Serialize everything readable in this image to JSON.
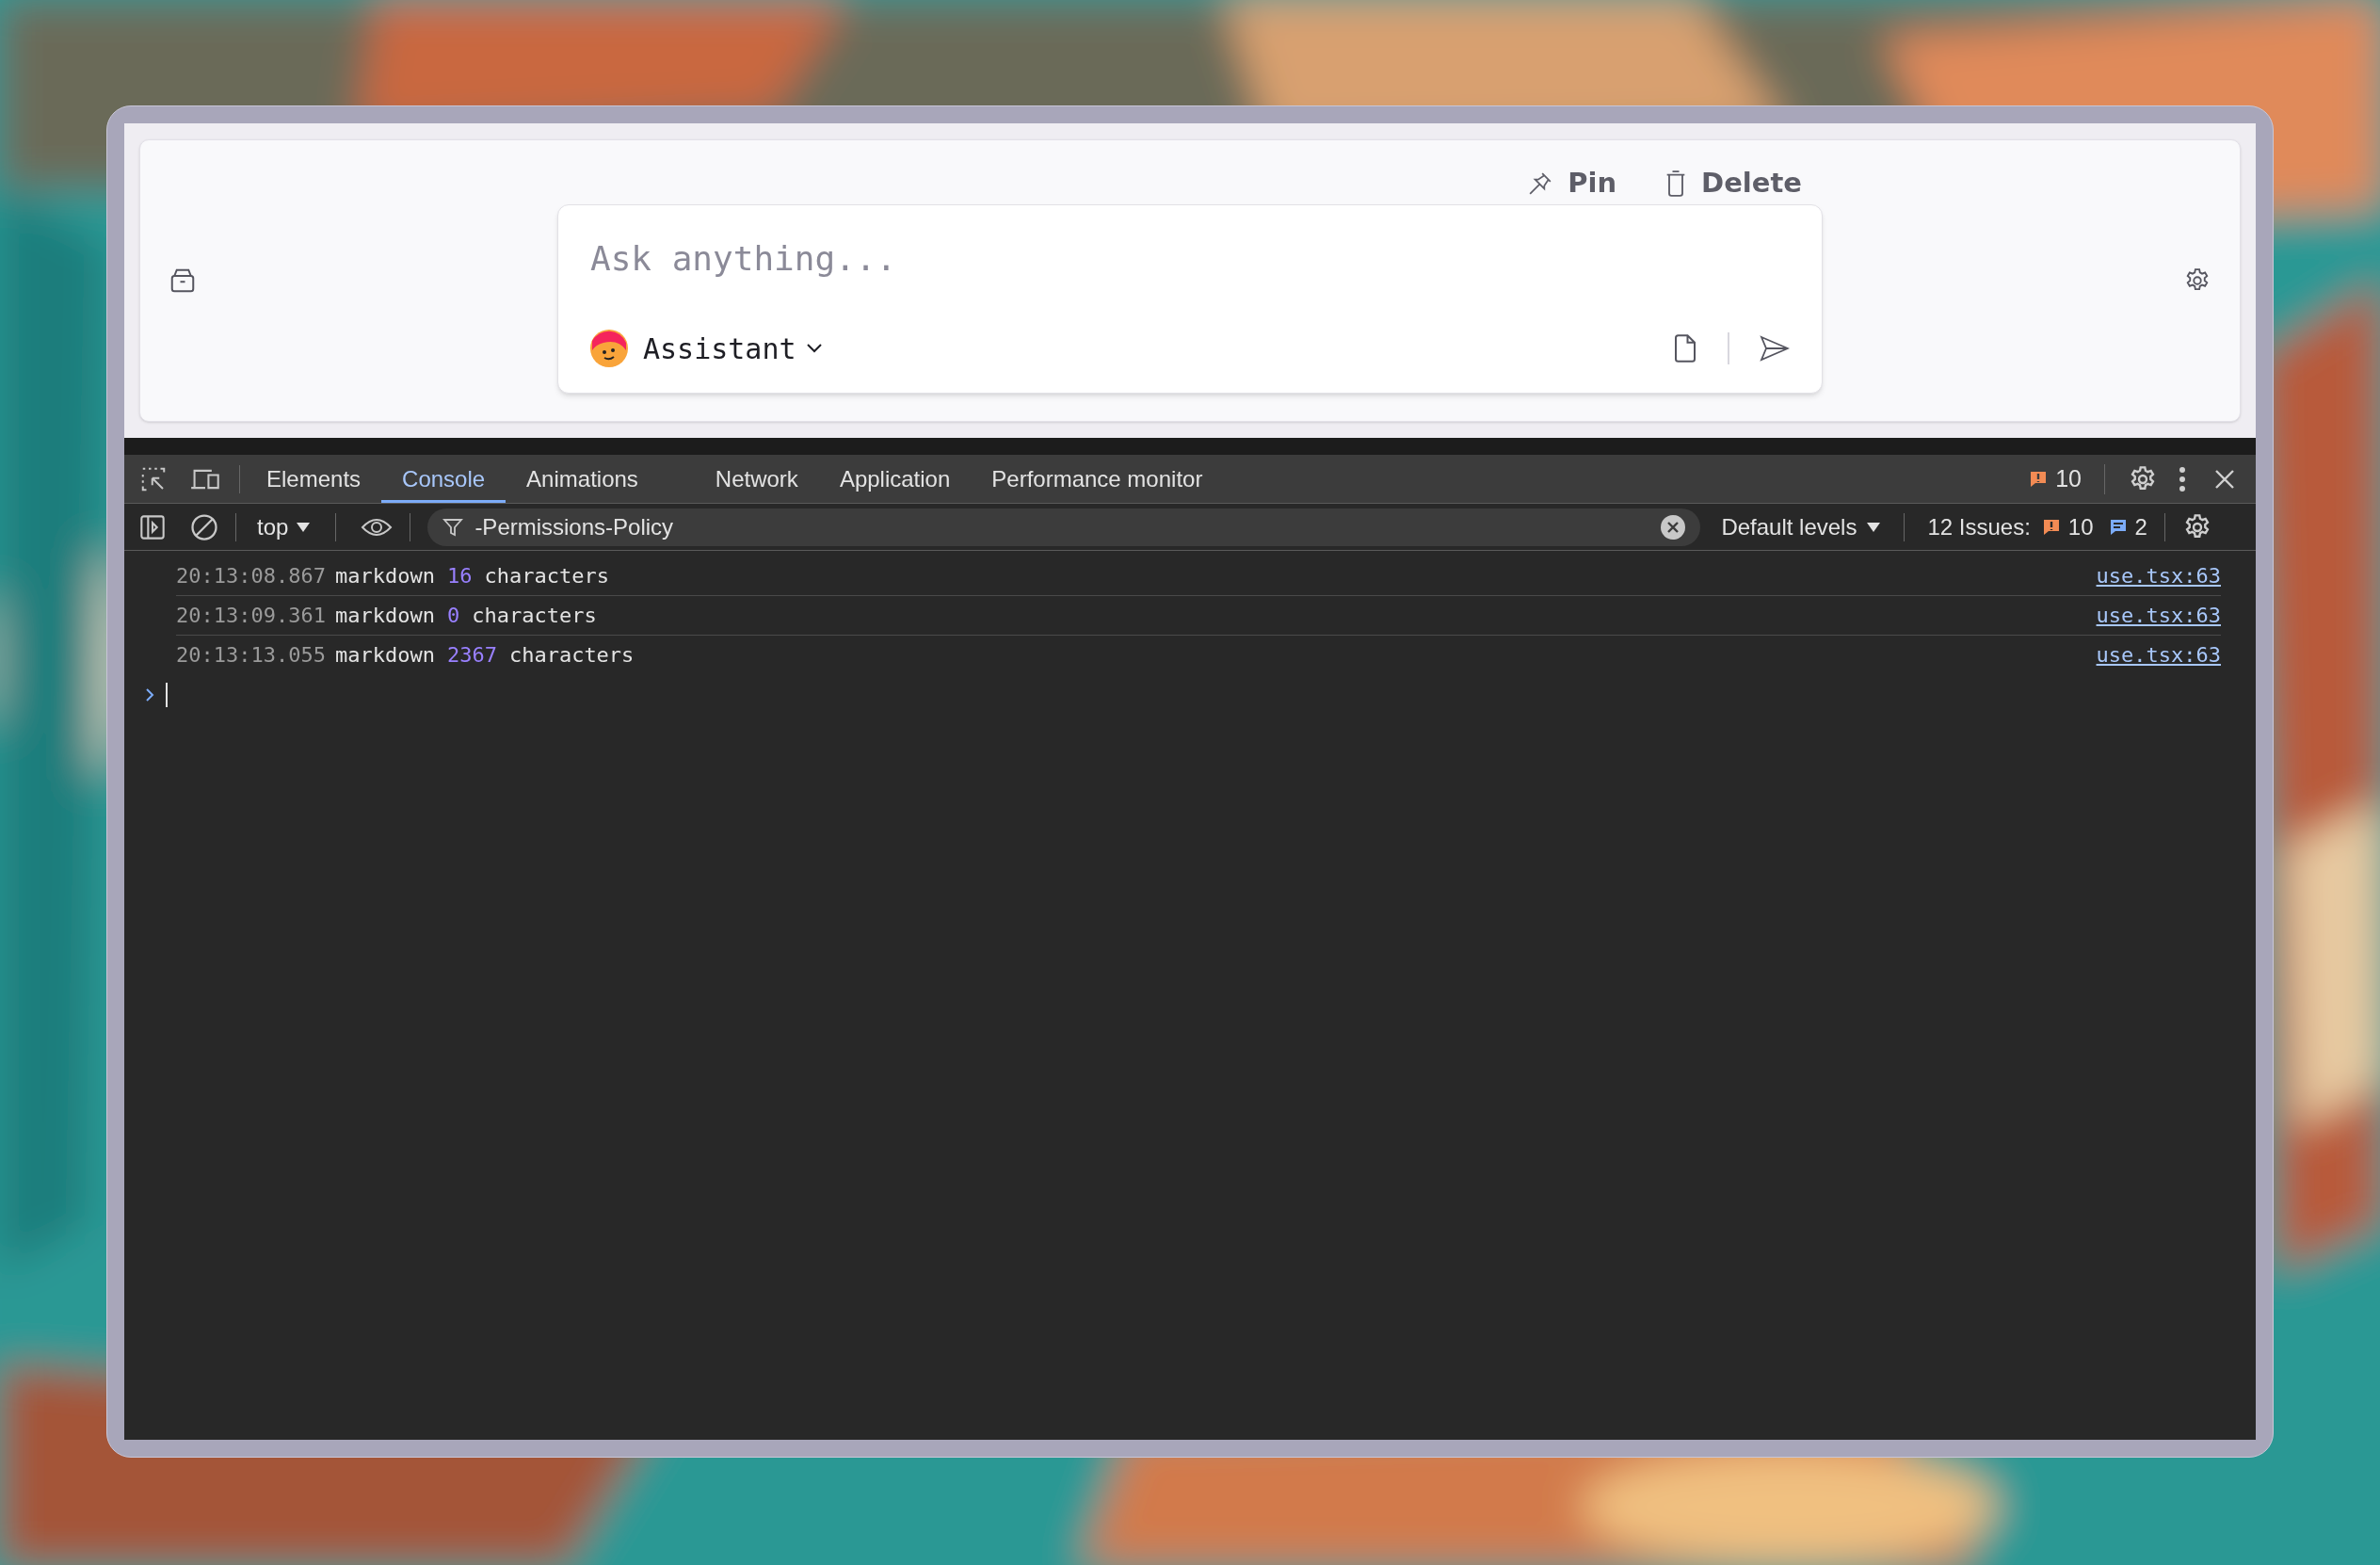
{
  "chat": {
    "actions": [
      {
        "kind": "pin",
        "label": "Pin"
      },
      {
        "kind": "delete",
        "label": "Delete"
      }
    ],
    "input": {
      "placeholder": "Ask anything..."
    },
    "agent": {
      "label": "Assistant"
    }
  },
  "devtools": {
    "tabs": [
      {
        "label": "Elements",
        "selected": false
      },
      {
        "label": "Console",
        "selected": true
      },
      {
        "label": "Animations",
        "selected": false
      },
      {
        "label": "Network",
        "selected": false
      },
      {
        "label": "Application",
        "selected": false
      },
      {
        "label": "Performance monitor",
        "selected": false
      }
    ],
    "issues_badge": "10",
    "toolbar": {
      "context": "top",
      "filter": "-Permissions-Policy",
      "levels": "Default levels",
      "issues_label": "12 Issues:",
      "warnings": "10",
      "infos": "2"
    },
    "rows": [
      {
        "time": "20:13:08.867",
        "message": "markdown",
        "count": "16",
        "unit": "characters",
        "source": "use.tsx:63"
      },
      {
        "time": "20:13:09.361",
        "message": "markdown",
        "count": "0",
        "unit": "characters",
        "source": "use.tsx:63"
      },
      {
        "time": "20:13:13.055",
        "message": "markdown",
        "count": "2367",
        "unit": "characters",
        "source": "use.tsx:63"
      }
    ]
  }
}
